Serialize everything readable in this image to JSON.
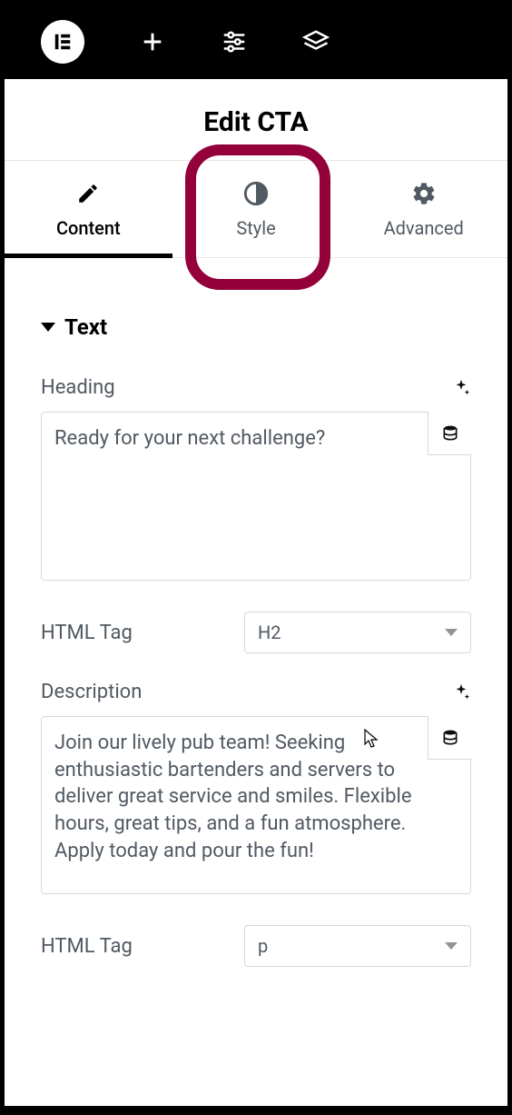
{
  "topbar": {
    "logo_text": "E"
  },
  "title": "Edit CTA",
  "tabs": {
    "content": "Content",
    "style": "Style",
    "advanced": "Advanced",
    "active": "content"
  },
  "section": {
    "title": "Text"
  },
  "fields": {
    "heading_label": "Heading",
    "heading_value": "Ready for your next challenge?",
    "heading_tag_label": "HTML Tag",
    "heading_tag_value": "H2",
    "description_label": "Description",
    "description_value": "Join our lively pub team! Seeking enthusiastic bartenders and servers to deliver great service and smiles. Flexible hours, great tips, and a fun atmosphere. Apply today and pour the fun!",
    "description_tag_label": "HTML Tag",
    "description_tag_value": "p"
  }
}
